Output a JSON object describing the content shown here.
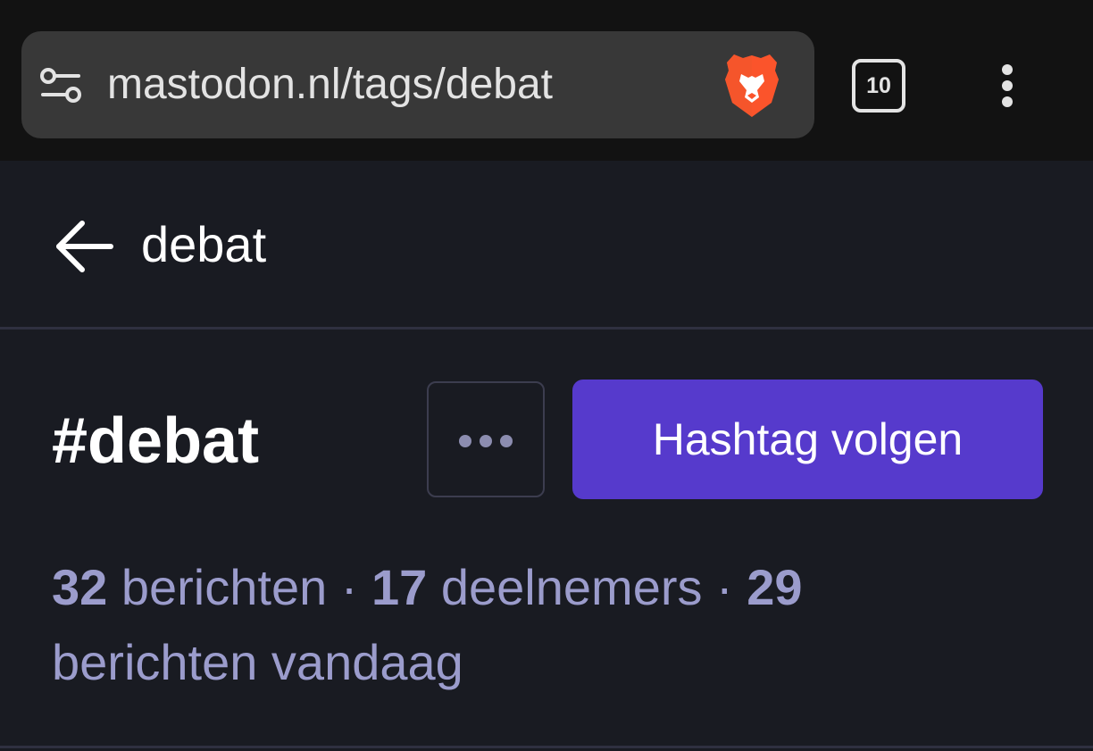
{
  "browser": {
    "url": "mastodon.nl/tags/debat",
    "tab_count": "10",
    "icons": {
      "site_settings": "site-settings-icon",
      "brave": "brave-lion-icon",
      "menu": "more-vertical-icon"
    }
  },
  "header": {
    "title": "debat"
  },
  "hashtag": {
    "name": "#debat",
    "follow_label": "Hashtag volgen",
    "stats": {
      "posts_count": "32",
      "posts_label": "berichten",
      "participants_count": "17",
      "participants_label": "deelnemers",
      "today_count": "29",
      "today_label": "berichten vandaag",
      "separator": "·"
    }
  },
  "colors": {
    "accent": "#563acc",
    "background": "#191b22",
    "stats_text": "#9b9ccc",
    "brave_orange": "#fb542b"
  }
}
